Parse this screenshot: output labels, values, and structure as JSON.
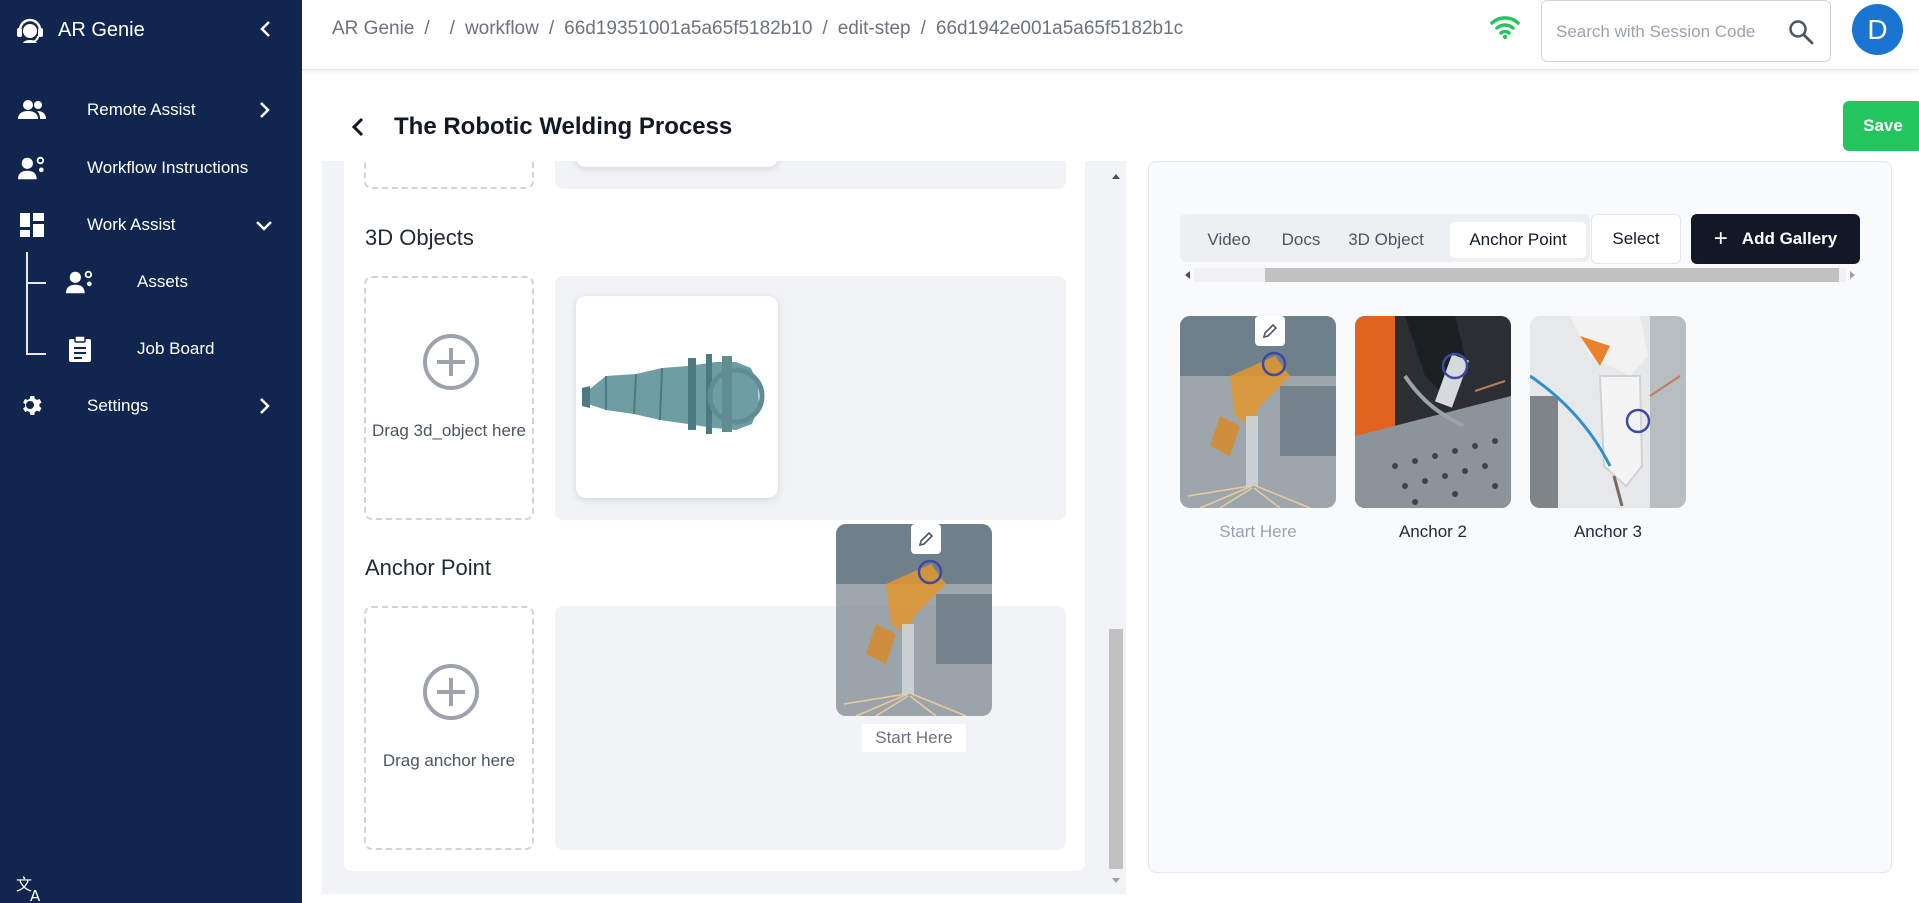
{
  "app": {
    "name": "AR Genie"
  },
  "sidebar": {
    "items": [
      {
        "label": "Remote Assist",
        "icon": "people-icon"
      },
      {
        "label": "Workflow Instructions",
        "icon": "workflow-user-icon"
      },
      {
        "label": "Work Assist",
        "icon": "dashboard-icon"
      },
      {
        "label": "Assets",
        "icon": "assets-user-icon"
      },
      {
        "label": "Job Board",
        "icon": "clipboard-icon"
      },
      {
        "label": "Settings",
        "icon": "gear-icon"
      }
    ]
  },
  "breadcrumb": [
    "AR Genie",
    "/",
    "",
    "/",
    "workflow",
    "/",
    "66d19351001a5a65f5182b10",
    "/",
    "edit-step",
    "/",
    "66d1942e001a5a65f5182b1c"
  ],
  "search": {
    "placeholder": "Search with Session Code"
  },
  "user": {
    "initial": "D"
  },
  "page": {
    "title": "The Robotic Welding Process",
    "save_label": "Save"
  },
  "sections": {
    "objects": {
      "title": "3D Objects",
      "drop_label": "Drag 3d_object here"
    },
    "anchor": {
      "title": "Anchor Point",
      "drop_label": "Drag anchor here"
    }
  },
  "dragged": {
    "caption": "Start Here"
  },
  "gallery": {
    "tabs": [
      "Video",
      "Docs",
      "3D Object",
      "Anchor Point"
    ],
    "active_tab": "Anchor Point",
    "select_label": "Select",
    "add_label": "Add Gallery",
    "items": [
      {
        "caption": "Start Here"
      },
      {
        "caption": "Anchor 2"
      },
      {
        "caption": "Anchor 3"
      }
    ]
  },
  "colors": {
    "sidebar": "#10264f",
    "save": "#22c55e",
    "avatar": "#1a75d2",
    "wifi": "#22c55e",
    "dark_button": "#111827"
  }
}
